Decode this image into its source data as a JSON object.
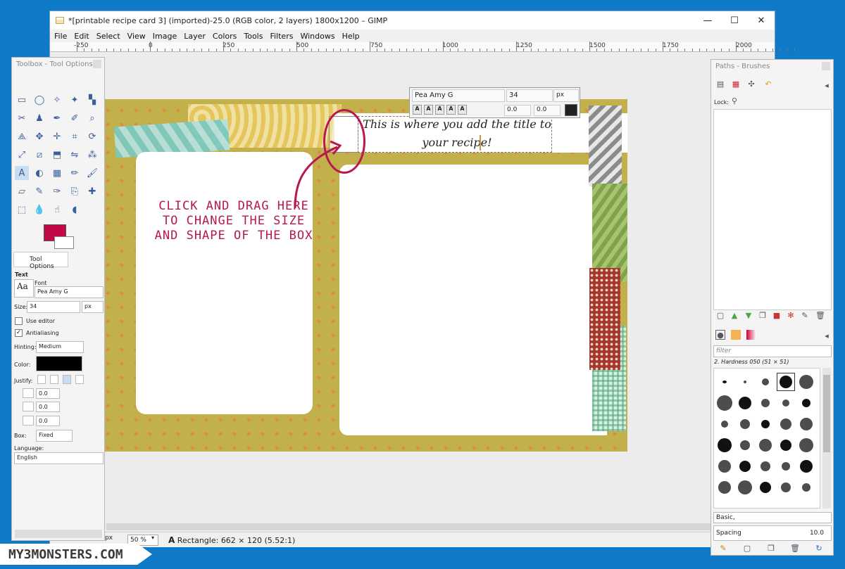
{
  "window": {
    "title": "*[printable recipe card 3] (imported)-25.0 (RGB color, 2 layers) 1800x1200 – GIMP",
    "minimize": "—",
    "maximize": "☐",
    "close": "✕"
  },
  "menu": [
    "File",
    "Edit",
    "Select",
    "View",
    "Image",
    "Layer",
    "Colors",
    "Tools",
    "Filters",
    "Windows",
    "Help"
  ],
  "ruler": {
    "labels": [
      "-250",
      "0",
      "250",
      "500",
      "750",
      "1000",
      "1250",
      "1500",
      "1750",
      "2000"
    ]
  },
  "text_toolbar": {
    "font": "Pea Amy G",
    "size": "34",
    "unit": "px",
    "baseline": "0.0",
    "kerning": "0.0",
    "text_color": "#222222"
  },
  "canvas": {
    "title_text": "This is where you add the title to your recipe!",
    "annotation": "CLICK AND DRAG HERE TO CHANGE THE SIZE AND SHAPE OF THE BOX",
    "annotation_color": "#b8174f",
    "card_color": "#c2b04a",
    "dot_color": "#e0864f"
  },
  "statusbar": {
    "unit": "px",
    "zoom": "50 %",
    "tool_label": "Rectangle:",
    "status": "662 × 120  (5.52:1)"
  },
  "toolbox": {
    "header": "Toolbox - Tool Options",
    "fg_color": "#c20849",
    "bg_color": "#ffffff",
    "tab_label": "Tool Options",
    "section": "Text",
    "font_label": "Font",
    "font_value": "Pea Amy G",
    "size_label": "Size:",
    "size_value": "34",
    "size_unit": "px",
    "use_editor": "Use editor",
    "antialiasing": "Antialiasing",
    "hinting_label": "Hinting:",
    "hinting_value": "Medium",
    "color_label": "Color:",
    "justify_label": "Justify:",
    "indent": "0.0",
    "line_spacing": "0.0",
    "letter_spacing": "0.0",
    "box_label": "Box:",
    "box_value": "Fixed",
    "language_label": "Language:",
    "language_value": "English"
  },
  "right_dock": {
    "header": "Paths - Brushes",
    "lock_label": "Lock:",
    "filter_placeholder": "filter",
    "brush_name": "2. Hardness 050 (51 × 51)",
    "preset": "Basic,",
    "spacing_label": "Spacing",
    "spacing_value": "10.0"
  },
  "watermark": "MY3MONSTERS.COM"
}
